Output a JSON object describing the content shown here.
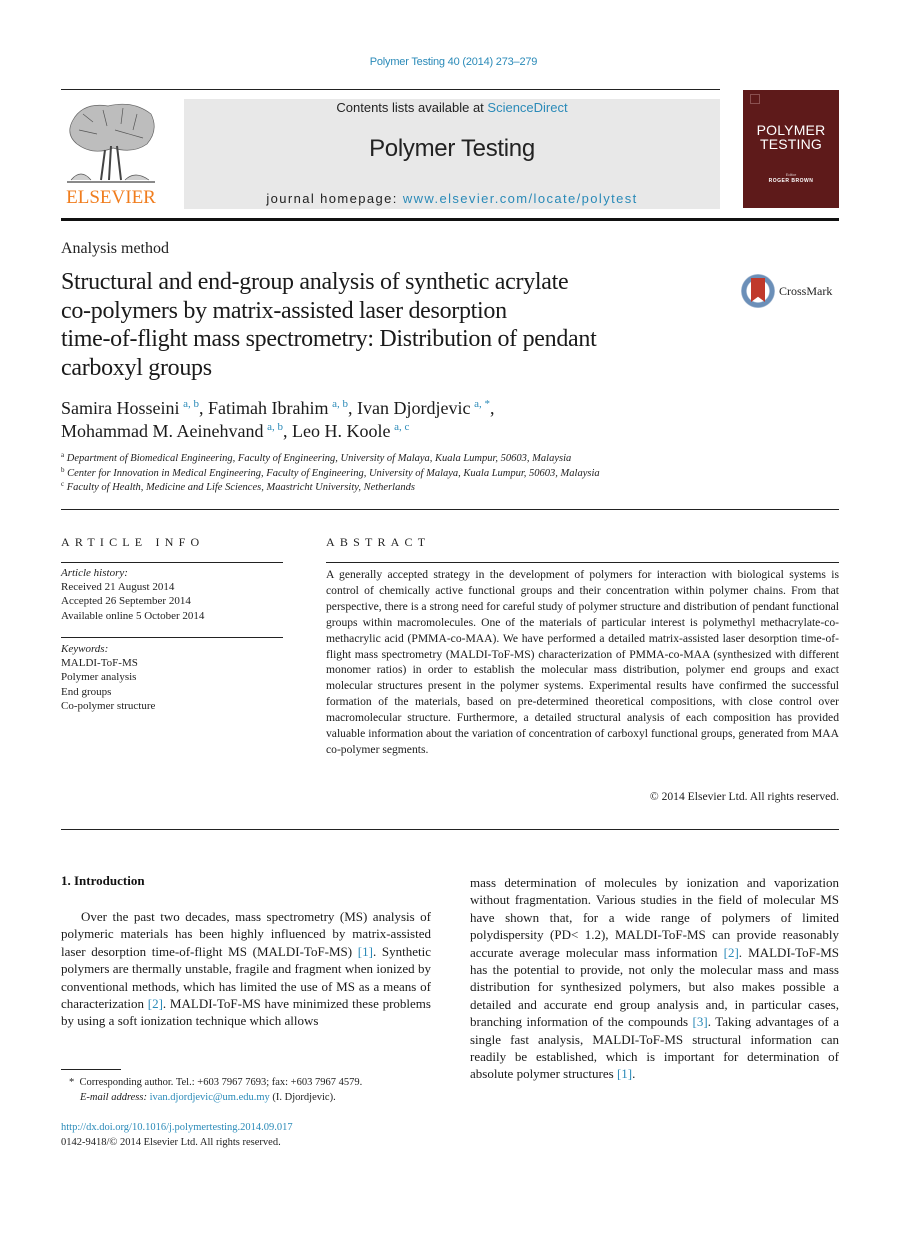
{
  "header": {
    "citation": "Polymer Testing 40 (2014) 273–279",
    "publisher_wordmark": "ELSEVIER",
    "contents_prefix": "Contents lists available at ",
    "contents_link": "ScienceDirect",
    "journal_title": "Polymer Testing",
    "homepage_prefix": "journal homepage: ",
    "homepage_link": "www.elsevier.com/locate/polytest",
    "cover": {
      "title_line1": "POLYMER",
      "title_line2": "TESTING",
      "editor_label": "Editor",
      "editor_name": "ROGER BROWN"
    },
    "colors": {
      "link": "#2a8ab8",
      "elsevier_orange": "#f07d1e",
      "cover_bg": "#5e1a1a",
      "banner_bg": "#e8e8e8"
    }
  },
  "article": {
    "type": "Analysis method",
    "title": "Structural and end-group analysis of synthetic acrylate co-polymers by matrix-assisted laser desorption time-of-flight mass spectrometry: Distribution of pendant carboxyl groups",
    "title_lines": [
      "Structural and end-group analysis of synthetic acrylate",
      "co-polymers by matrix-assisted laser desorption",
      "time-of-flight mass spectrometry: Distribution of pendant",
      "carboxyl groups"
    ],
    "crossmark_label": "CrossMark",
    "authors": [
      {
        "name": "Samira Hosseini",
        "affil": "a, b",
        "sep": ", "
      },
      {
        "name": "Fatimah Ibrahim",
        "affil": "a, b",
        "sep": ", "
      },
      {
        "name": "Ivan Djordjevic",
        "affil": "a, *",
        "sep": ","
      },
      {
        "name": "Mohammad M. Aeinehvand",
        "affil": "a, b",
        "sep": ", "
      },
      {
        "name": "Leo H. Koole",
        "affil": "a, c",
        "sep": ""
      }
    ],
    "affiliations": [
      {
        "key": "a",
        "text": "Department of Biomedical Engineering, Faculty of Engineering, University of Malaya, Kuala Lumpur, 50603, Malaysia"
      },
      {
        "key": "b",
        "text": "Center for Innovation in Medical Engineering, Faculty of Engineering, University of Malaya, Kuala Lumpur, 50603, Malaysia"
      },
      {
        "key": "c",
        "text": "Faculty of Health, Medicine and Life Sciences, Maastricht University, Netherlands"
      }
    ]
  },
  "article_info": {
    "heading": "ARTICLE INFO",
    "history_label": "Article history:",
    "history": [
      "Received 21 August 2014",
      "Accepted 26 September 2014",
      "Available online 5 October 2014"
    ],
    "keywords_label": "Keywords:",
    "keywords": [
      "MALDI-ToF-MS",
      "Polymer analysis",
      "End groups",
      "Co-polymer structure"
    ]
  },
  "abstract": {
    "heading": "ABSTRACT",
    "text": "A generally accepted strategy in the development of polymers for interaction with biological systems is control of chemically active functional groups and their concentration within polymer chains. From that perspective, there is a strong need for careful study of polymer structure and distribution of pendant functional groups within macromolecules. One of the materials of particular interest is polymethyl methacrylate-co-methacrylic acid (PMMA-co-MAA). We have performed a detailed matrix-assisted laser desorption time-of-flight mass spectrometry (MALDI-ToF-MS) characterization of PMMA-co-MAA (synthesized with different monomer ratios) in order to establish the molecular mass distribution, polymer end groups and exact molecular structures present in the polymer systems. Experimental results have confirmed the successful formation of the materials, based on pre-determined theoretical compositions, with close control over macromolecular structure. Furthermore, a detailed structural analysis of each composition has provided valuable information about the variation of concentration of carboxyl functional groups, generated from MAA co-polymer segments.",
    "copyright": "© 2014 Elsevier Ltd. All rights reserved."
  },
  "body": {
    "section_title": "1.  Introduction",
    "left_col": [
      {
        "t": "Over the past two decades, mass spectrometry (MS) analysis of polymeric materials has been highly influenced by matrix-assisted laser desorption time-of-flight MS (MALDI-ToF-MS) "
      },
      {
        "ref": "[1]"
      },
      {
        "t": ". Synthetic polymers are thermally unstable, fragile and fragment when ionized by conventional methods, which has limited the use of MS as a means of characterization "
      },
      {
        "ref": "[2]"
      },
      {
        "t": ". MALDI-ToF-MS have minimized these problems by using a soft ionization technique which allows"
      }
    ],
    "right_col": [
      {
        "t": "mass determination of molecules by ionization and vaporization without fragmentation. Various studies in the field of molecular MS have shown that, for a wide range of polymers of limited polydispersity (PD< 1.2), MALDI-ToF-MS can provide reasonably accurate average molecular mass information "
      },
      {
        "ref": "[2]"
      },
      {
        "t": ". MALDI-ToF-MS has the potential to provide, not only the molecular mass and mass distribution for synthesized polymers, but also makes possible a detailed and accurate end group analysis and, in particular cases, branching information of the compounds "
      },
      {
        "ref": "[3]"
      },
      {
        "t": ". Taking advantages of a single fast analysis, MALDI-ToF-MS structural information can readily be established, which is important for determination of absolute polymer structures "
      },
      {
        "ref": "[1]"
      },
      {
        "t": "."
      }
    ]
  },
  "footnote": {
    "marker": "*",
    "corresponding": "Corresponding author. Tel.: +603 7967 7693; fax: +603 7967 4579.",
    "email_label": "E-mail address:",
    "email": "ivan.djordjevic@um.edu.my",
    "email_suffix": " (I. Djordjevic).",
    "doi": "http://dx.doi.org/10.1016/j.polymertesting.2014.09.017",
    "issn": "0142-9418/© 2014 Elsevier Ltd. All rights reserved."
  }
}
